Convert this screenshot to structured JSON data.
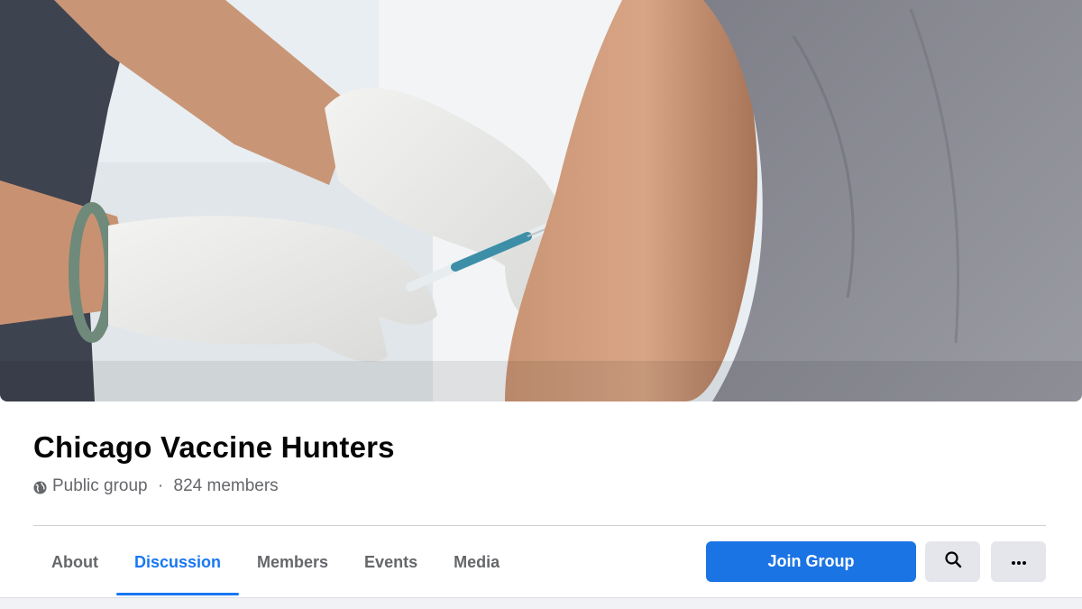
{
  "group": {
    "name": "Chicago Vaccine Hunters",
    "privacy": "Public group",
    "separator": " · ",
    "member_count": "824 members"
  },
  "tabs": [
    {
      "label": "About",
      "active": false
    },
    {
      "label": "Discussion",
      "active": true
    },
    {
      "label": "Members",
      "active": false
    },
    {
      "label": "Events",
      "active": false
    },
    {
      "label": "Media",
      "active": false
    }
  ],
  "actions": {
    "join_label": "Join Group",
    "search_icon": "search-icon",
    "more_icon": "more-horizontal-icon"
  },
  "colors": {
    "accent": "#1877f2",
    "join_button": "#1b74e4",
    "secondary_button": "#e4e6eb",
    "muted_text": "#65676b"
  },
  "cover_photo": {
    "icon": "cover-photo-vaccination"
  }
}
